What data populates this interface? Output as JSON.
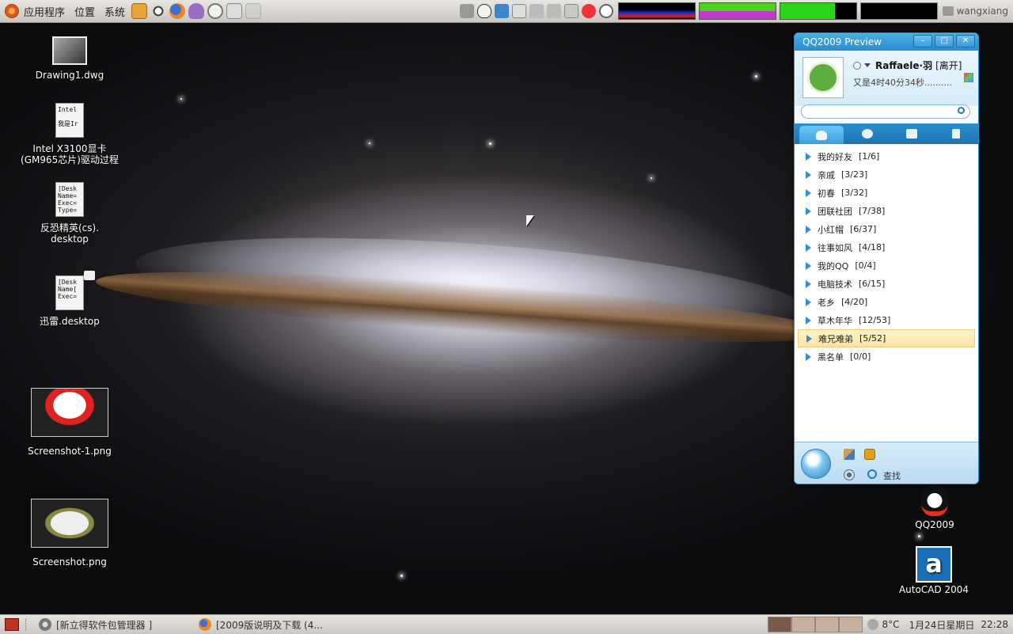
{
  "top_panel": {
    "menus": [
      "应用程序",
      "位置",
      "系统"
    ],
    "user": "wangxiang"
  },
  "desktop_icons": [
    {
      "label": "Drawing1.dwg",
      "thumb_text": ""
    },
    {
      "label": "Intel X3100显卡\n(GM965芯片)驱动过程",
      "thumb_text": "Intel\n\n我是Ir"
    },
    {
      "label": "反恐精英(cs).\ndesktop",
      "thumb_text": "[Desk\nName=\nExec=\nType="
    },
    {
      "label": "迅雷.desktop",
      "thumb_text": "[Desk\nName[\nExec="
    },
    {
      "label": "Screenshot-1.png"
    },
    {
      "label": "Screenshot.png"
    },
    {
      "label": "QQ2009"
    },
    {
      "label": "AutoCAD 2004"
    }
  ],
  "qq": {
    "title": "QQ2009 Preview",
    "nickname": "Raffaele·羽",
    "status": "[离开]",
    "signature": "又是4时40分34秒..........",
    "search_placeholder": "",
    "groups": [
      {
        "name": "我的好友",
        "count": "[1/6]"
      },
      {
        "name": "亲戚",
        "count": "[3/23]"
      },
      {
        "name": "初春",
        "count": "[3/32]"
      },
      {
        "name": "团联社团",
        "count": "[7/38]"
      },
      {
        "name": "小红帽",
        "count": "[6/37]"
      },
      {
        "name": "往事如风",
        "count": "[4/18]"
      },
      {
        "name": "我的QQ",
        "count": "[0/4]"
      },
      {
        "name": "电脑技术",
        "count": "[6/15]"
      },
      {
        "name": "老乡",
        "count": "[4/20]"
      },
      {
        "name": "草木年华",
        "count": "[12/53]"
      },
      {
        "name": "难兄难弟",
        "count": "[5/52]",
        "selected": true
      },
      {
        "name": "黑名单",
        "count": "[0/0]"
      }
    ],
    "find_label": "查找"
  },
  "taskbar": {
    "tasks": [
      "[新立得软件包管理器 ]",
      "[2009版说明及下载 (4..."
    ],
    "temperature": "8°C",
    "date": "1月24日星期日",
    "time": "22:28"
  },
  "colors": {
    "qq_blue": "#2a8ccf",
    "selected_group": "#fbe4a4",
    "panel": "#d8d6d2"
  }
}
